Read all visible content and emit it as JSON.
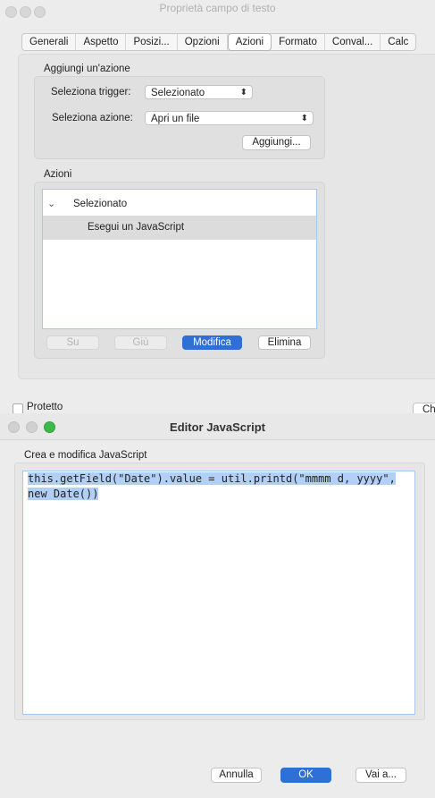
{
  "background_hint_text": "Aggiungi... ] Selezionato",
  "properties_dialog": {
    "title": "Proprietà campo di testo",
    "tabs": [
      "Generali",
      "Aspetto",
      "Posizi...",
      "Opzioni",
      "Azioni",
      "Formato",
      "Conval...",
      "Calc"
    ],
    "active_tab": "Azioni",
    "add_action": {
      "group_label": "Aggiungi un'azione",
      "trigger_label": "Seleziona trigger:",
      "trigger_value": "Selezionato",
      "action_label": "Seleziona azione:",
      "action_value": "Apri un file",
      "add_button": "Aggiungi..."
    },
    "actions": {
      "group_label": "Azioni",
      "tree": {
        "parent": "Selezionato",
        "child": "Esegui un JavaScript"
      },
      "buttons": {
        "up": "Su",
        "down": "Giù",
        "edit": "Modifica",
        "delete": "Elimina"
      }
    },
    "protected_label": "Protetto",
    "close_button_partial": "Ch"
  },
  "js_editor": {
    "title": "Editor JavaScript",
    "subtitle": "Crea e modifica JavaScript",
    "code_lines": [
      "this.getField(\"Date\").value = util.printd(\"mmmm d, yyyy\",",
      "new Date())"
    ],
    "buttons": {
      "cancel": "Annulla",
      "ok": "OK",
      "goto": "Vai a..."
    }
  },
  "colors": {
    "accent": "#2f6fd6",
    "selection": "#b2cff5",
    "close_dot": "#e25b50",
    "minimize_dot": "#d0d0d0",
    "zoom_dot": "#3cb949"
  }
}
